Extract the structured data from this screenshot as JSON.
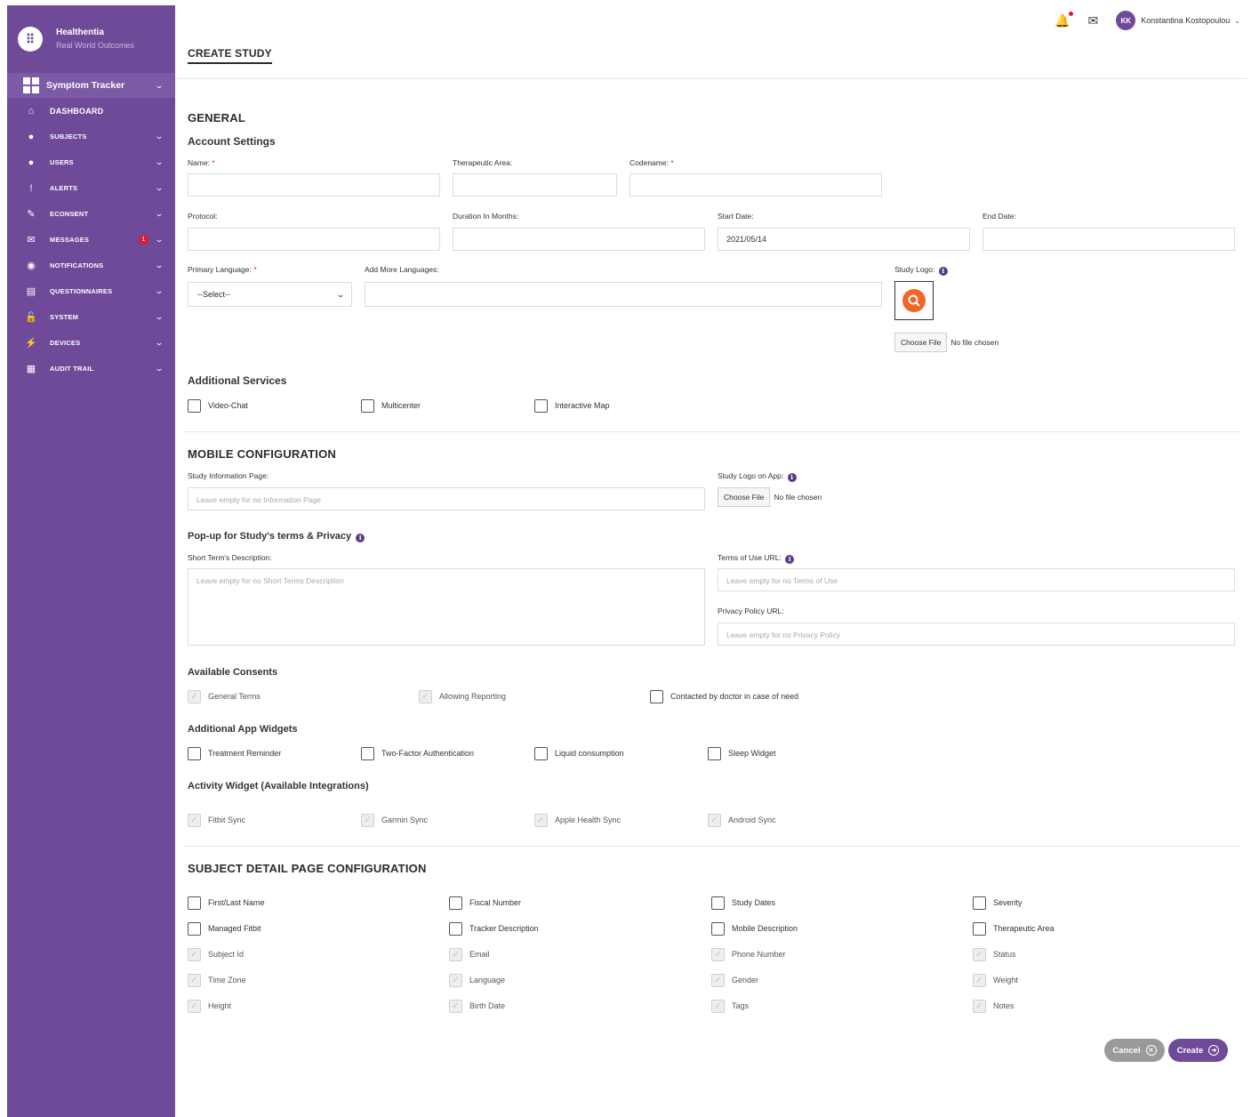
{
  "brand": {
    "name": "Healthentia",
    "subtitle": "Real World Outcomes",
    "logo_glyph": "⠿"
  },
  "sidebar": {
    "tracker": "Symptom Tracker",
    "items": [
      {
        "label": "DASHBOARD",
        "icon": "home-icon"
      },
      {
        "label": "SUBJECTS",
        "icon": "person-icon"
      },
      {
        "label": "USERS",
        "icon": "person-icon"
      },
      {
        "label": "ALERTS",
        "icon": "alert-icon"
      },
      {
        "label": "ECONSENT",
        "icon": "pencil-icon"
      },
      {
        "label": "MESSAGES",
        "icon": "chat-icon",
        "badge": "1"
      },
      {
        "label": "NOTIFICATIONS",
        "icon": "notification-icon"
      },
      {
        "label": "QUESTIONNAIRES",
        "icon": "list-icon"
      },
      {
        "label": "SYSTEM",
        "icon": "unlock-icon"
      },
      {
        "label": "DEVICES",
        "icon": "plug-icon"
      },
      {
        "label": "AUDIT TRAIL",
        "icon": "audit-icon"
      }
    ]
  },
  "topbar": {
    "initials": "KK",
    "user_name": "Konstantina Kostopoulou"
  },
  "page_title": "CREATE STUDY",
  "general": {
    "title": "GENERAL",
    "account_settings": "Account Settings",
    "name_label": "Name:",
    "therapeutic_label": "Therapeutic Area:",
    "codename_label": "Codename:",
    "protocol_label": "Protocol:",
    "duration_label": "Duration In Months:",
    "start_label": "Start Date:",
    "start_value": "2021/05/14",
    "end_label": "End Date:",
    "primary_lang_label": "Primary Language:",
    "primary_lang_value": "--Select--",
    "more_lang_label": "Add More Languages:",
    "study_logo_label": "Study Logo:",
    "choose_file": "Choose File",
    "no_file": "No file chosen",
    "required_mark": "*",
    "additional_services": "Additional Services",
    "services": [
      "Video-Chat",
      "Multicenter",
      "Interactive Map"
    ]
  },
  "mobile": {
    "title": "MOBILE CONFIGURATION",
    "info_page_label": "Study Information Page:",
    "info_page_placeholder": "Leave empty for no Information Page",
    "logo_app_label": "Study Logo on App:",
    "choose_file": "Choose File",
    "no_file": "No file chosen",
    "popup_title": "Pop-up for Study's terms & Privacy",
    "short_terms_label": "Short Term's Description:",
    "short_terms_placeholder": "Leave empty for no Short Terms Description",
    "terms_url_label": "Terms of Use URL:",
    "terms_url_placeholder": "Leave empty for no Terms of Use",
    "privacy_url_label": "Privacy Policy URL:",
    "privacy_url_placeholder": "Leave empty for no Privacy Policy",
    "consents_title": "Available Consents",
    "consents": [
      {
        "label": "General Terms",
        "disabled": true
      },
      {
        "label": "Allowing Reporting",
        "disabled": true
      },
      {
        "label": "Contacted by doctor in case of need",
        "disabled": false
      }
    ],
    "widgets_title": "Additional App Widgets",
    "widgets": [
      "Treatment Reminder",
      "Two-Factor Authentication",
      "Liquid consumption",
      "Sleep Widget"
    ],
    "activity_title": "Activity Widget (Available Integrations)",
    "activity": [
      "Fitbit Sync",
      "Garmin Sync",
      "Apple Health Sync",
      "Android Sync"
    ]
  },
  "subject_detail": {
    "title": "SUBJECT DETAIL PAGE CONFIGURATION",
    "rows": [
      [
        {
          "label": "First/Last Name",
          "disabled": false
        },
        {
          "label": "Fiscal Number",
          "disabled": false
        },
        {
          "label": "Study Dates",
          "disabled": false
        },
        {
          "label": "Severity",
          "disabled": false
        }
      ],
      [
        {
          "label": "Managed Fitbit",
          "disabled": false
        },
        {
          "label": "Tracker Description",
          "disabled": false
        },
        {
          "label": "Mobile Description",
          "disabled": false
        },
        {
          "label": "Therapeutic Area",
          "disabled": false
        }
      ],
      [
        {
          "label": "Subject Id",
          "disabled": true
        },
        {
          "label": "Email",
          "disabled": true
        },
        {
          "label": "Phone Number",
          "disabled": true
        },
        {
          "label": "Status",
          "disabled": true
        }
      ],
      [
        {
          "label": "Time Zone",
          "disabled": true
        },
        {
          "label": "Language",
          "disabled": true
        },
        {
          "label": "Gender",
          "disabled": true
        },
        {
          "label": "Weight",
          "disabled": true
        }
      ],
      [
        {
          "label": "Height",
          "disabled": true
        },
        {
          "label": "Birth Date",
          "disabled": true
        },
        {
          "label": "Tags",
          "disabled": true
        },
        {
          "label": "Notes",
          "disabled": true
        }
      ]
    ]
  },
  "actions": {
    "cancel": "Cancel",
    "create": "Create"
  },
  "colors": {
    "sidebar": "#6f4a99",
    "primary": "#6f4a99",
    "cancel": "#9a9a9a",
    "badge": "#e01b2b",
    "logo": "#f26522"
  }
}
